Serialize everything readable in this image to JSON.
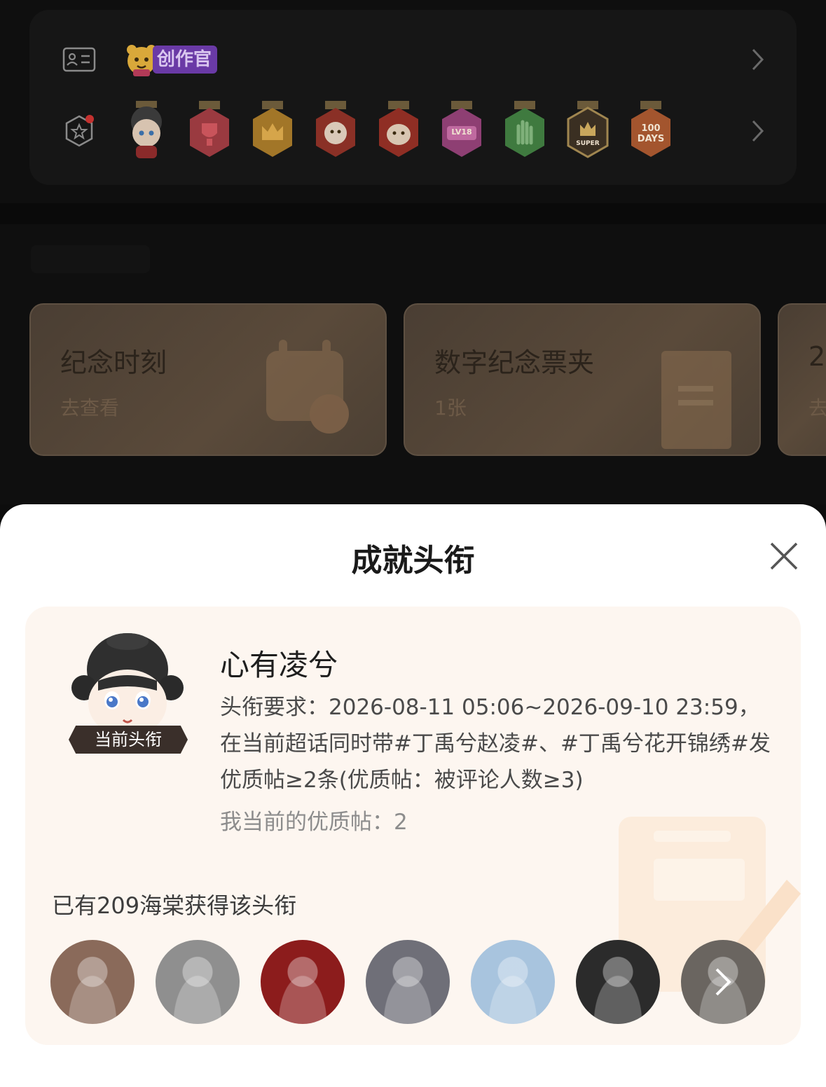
{
  "badges_section": {
    "creator_tag": "创作官",
    "medals": [
      {
        "name": "avatar-medal",
        "label": ""
      },
      {
        "name": "trophy-medal",
        "label": ""
      },
      {
        "name": "crown-medal",
        "label": ""
      },
      {
        "name": "dragon-medal",
        "label": ""
      },
      {
        "name": "snake-medal",
        "label": ""
      },
      {
        "name": "lv-medal",
        "label": "LV18"
      },
      {
        "name": "hand-medal",
        "label": ""
      },
      {
        "name": "super-medal",
        "label": "SUPER"
      },
      {
        "name": "days-medal",
        "label": "100 DAYS"
      }
    ]
  },
  "feature_cards": [
    {
      "title": "纪念时刻",
      "subtitle": "去查看"
    },
    {
      "title": "数字纪念票夹",
      "subtitle": "1张"
    },
    {
      "title": "2",
      "subtitle": "去"
    }
  ],
  "sheet": {
    "title": "成就头衔",
    "current_label": "当前头衔",
    "badge_name": "心有凌兮",
    "requirement": "头衔要求：2026-08-11 05:06~2026-09-10 23:59，在当前超话同时带#丁禹兮赵凌#、#丁禹兮花开锦绣#发优质帖≥2条(优质帖：被评论人数≥3)",
    "my_posts": "我当前的优质帖：2",
    "holders_text": "已有209海棠获得该头衔",
    "avatar_colors": [
      "#8a6a5a",
      "#8f8f8f",
      "#8c1c1c",
      "#6f6f78",
      "#a8c4de",
      "#2b2b2b",
      "#6a6560"
    ]
  }
}
